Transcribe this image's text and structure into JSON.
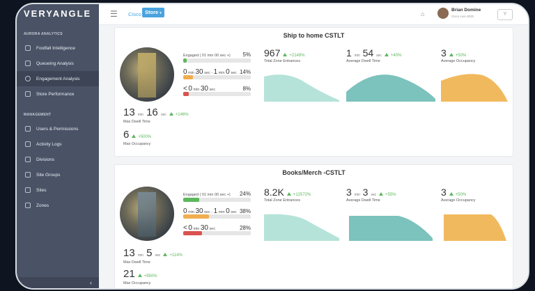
{
  "sidebar": {
    "brand": "VERYANGLE",
    "section1": "AURORA ANALYTICS",
    "items1": [
      {
        "label": "Footfall Intelligence"
      },
      {
        "label": "Queueing Analysis"
      },
      {
        "label": "Engagement Analysis"
      },
      {
        "label": "Store Performance"
      }
    ],
    "section2": "MANAGEMENT",
    "items2": [
      {
        "label": "Users & Permissions"
      },
      {
        "label": "Activity Logs"
      },
      {
        "label": "Divisions"
      },
      {
        "label": "Site Groups"
      },
      {
        "label": "Sites"
      },
      {
        "label": "Zones"
      }
    ],
    "collapse": "‹"
  },
  "topbar": {
    "menu_icon": "☰",
    "org": "Cisco",
    "store_label": "Store",
    "store_caret": "▾",
    "home_icon": "⌂",
    "user_name": "Brian Domine",
    "user_sub": "Cisco Live 2025",
    "user_box": "Y"
  },
  "zones": [
    {
      "title": "Ship to home CSTLT",
      "engagement": [
        {
          "label": "Engaged ( 01 min 00 sec +)",
          "pct": "5%",
          "value": 5,
          "color": "#5cb85c"
        },
        {
          "label_a": "0",
          "label_b": "min",
          "label_c": "30",
          "label_d": "sec -",
          "label_e": "1",
          "label_f": "min",
          "label_g": "0",
          "label_h": "sec",
          "pct": "14%",
          "value": 14,
          "color": "#f0ad4e"
        },
        {
          "label_a": "<",
          "label_b": "0",
          "label_c": "min",
          "label_d": "30",
          "label_e": "sec",
          "pct": "8%",
          "value": 8,
          "color": "#d9534f"
        }
      ],
      "max_dwell": {
        "min": "13",
        "min_unit": "min",
        "sec": "16",
        "sec_unit": "sec",
        "change": "+146%",
        "label": "Max Dwell Time"
      },
      "max_occ": {
        "value": "6",
        "change": "+500%",
        "label": "Max Occupancy"
      },
      "tiles": [
        {
          "value": "967",
          "change": "+2148%",
          "label": "Total Zone Entrances",
          "color": "#a8ded2"
        },
        {
          "value_a": "1",
          "unit_a": "min",
          "value_b": "54",
          "unit_b": "sec",
          "change": "+40%",
          "label": "Average Dwell Time",
          "color": "#7cc2bd"
        },
        {
          "value": "3",
          "change": "+50%",
          "label": "Average Occupancy",
          "color": "#f1b95e"
        }
      ]
    },
    {
      "title": "Books/Merch -CSTLT",
      "engagement": [
        {
          "label": "Engaged ( 01 min 00 sec +)",
          "pct": "24%",
          "value": 24,
          "color": "#5cb85c"
        },
        {
          "label_a": "0",
          "label_b": "min",
          "label_c": "30",
          "label_d": "sec -",
          "label_e": "1",
          "label_f": "min",
          "label_g": "0",
          "label_h": "sec",
          "pct": "38%",
          "value": 38,
          "color": "#f0ad4e"
        },
        {
          "label_a": "<",
          "label_b": "0",
          "label_c": "min",
          "label_d": "30",
          "label_e": "sec",
          "pct": "28%",
          "value": 28,
          "color": "#d9534f"
        }
      ],
      "max_dwell": {
        "min": "13",
        "min_unit": "min",
        "sec": "5",
        "sec_unit": "sec",
        "change": "+114%",
        "label": "Max Dwell Time"
      },
      "max_occ": {
        "value": "21",
        "change": "+950%",
        "label": "Max Occupancy"
      },
      "tiles": [
        {
          "value": "8.2K",
          "change": "+12572%",
          "label": "Total Zone Entrances",
          "color": "#a8ded2"
        },
        {
          "value_a": "3",
          "unit_a": "min",
          "value_b": "3",
          "unit_b": "sec",
          "change": "+55%",
          "label": "Average Dwell Time",
          "color": "#7cc2bd"
        },
        {
          "value": "3",
          "change": "+50%",
          "label": "Average Occupancy",
          "color": "#f1b95e"
        }
      ]
    }
  ]
}
